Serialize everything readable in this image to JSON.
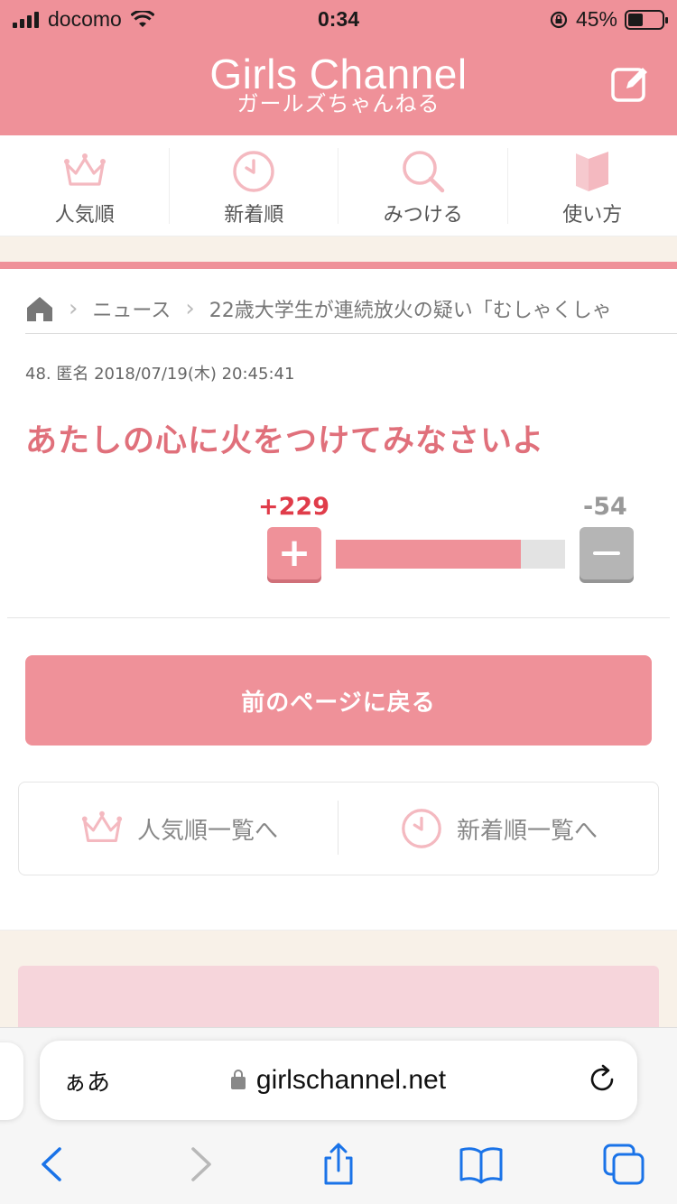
{
  "status_bar": {
    "carrier": "docomo",
    "time": "0:34",
    "battery": "45%"
  },
  "header": {
    "title_en": "Girls Channel",
    "title_ja": "ガールズちゃんねる"
  },
  "nav": [
    {
      "label": "人気順",
      "icon": "crown-icon"
    },
    {
      "label": "新着順",
      "icon": "clock-icon"
    },
    {
      "label": "みつける",
      "icon": "search-icon"
    },
    {
      "label": "使い方",
      "icon": "book-icon"
    }
  ],
  "breadcrumb": {
    "section": "ニュース",
    "topic": "22歳大学生が連続放火の疑い「むしゃくしゃ"
  },
  "comment": {
    "meta": "48. 匿名 2018/07/19(木) 20:45:41",
    "body": "あたしの心に火をつけてみなさいよ",
    "plus": "+229",
    "minus": "-54",
    "plus_symbol": "+",
    "plus_share": 0.809
  },
  "back_button": "前のページに戻る",
  "list_links": {
    "popular": "人気順一覧へ",
    "newest": "新着順一覧へ"
  },
  "browser": {
    "aa": "ぁあ",
    "url": "girlschannel.net"
  },
  "colors": {
    "brand_pink": "#ef9199",
    "comment_pink": "#e0707b",
    "plus_red": "#e03c4a",
    "ios_blue": "#1a73e8"
  }
}
